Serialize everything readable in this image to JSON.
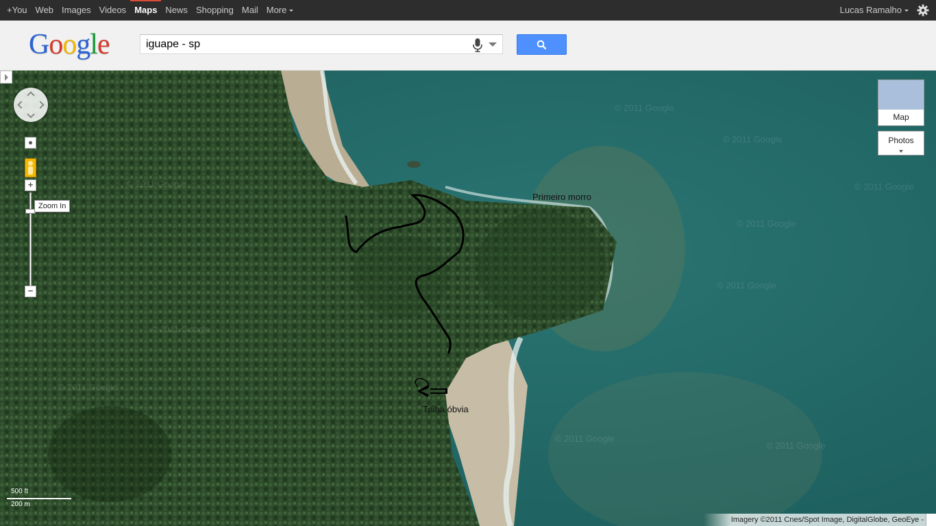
{
  "topbar": {
    "nav": [
      {
        "label": "+You",
        "active": false
      },
      {
        "label": "Web",
        "active": false
      },
      {
        "label": "Images",
        "active": false
      },
      {
        "label": "Videos",
        "active": false
      },
      {
        "label": "Maps",
        "active": true
      },
      {
        "label": "News",
        "active": false
      },
      {
        "label": "Shopping",
        "active": false
      },
      {
        "label": "Mail",
        "active": false
      },
      {
        "label": "More",
        "active": false
      }
    ],
    "user_name": "Lucas Ramalho",
    "settings_icon": "gear-icon"
  },
  "logo": {
    "letters": [
      "G",
      "o",
      "o",
      "g",
      "l",
      "e"
    ],
    "colors": [
      "#2b63d6",
      "#d8382a",
      "#f2b705",
      "#2b63d6",
      "#1a9b3c",
      "#d8382a"
    ]
  },
  "search": {
    "query": "iguape - sp",
    "mic_icon": "microphone-icon",
    "dropdown_icon": "chevron-down-icon",
    "button_icon": "search-icon"
  },
  "map": {
    "controls": {
      "pan_icon": "pan-control-icon",
      "reset_icon": "zoom-reset-icon",
      "pegman_icon": "pegman-icon",
      "zoom_in_label": "+",
      "zoom_out_label": "−",
      "tooltip": "Zoom In"
    },
    "map_types": {
      "map": "Map",
      "photos": "Photos"
    },
    "annotations": {
      "primeiro_morro": "Primeiro morro",
      "trilha": "Trilha óbvia"
    },
    "scale": {
      "imperial": "500 ft",
      "metric": "200 m"
    },
    "attribution": "Imagery ©2011 Cnes/Spot Image, DigitalGlobe, GeoEye -",
    "watermark": "© 2011 Google",
    "colors": {
      "forest": "#2c4a2a",
      "sea": "#1f6b6a",
      "sand": "#b9ad94"
    }
  }
}
